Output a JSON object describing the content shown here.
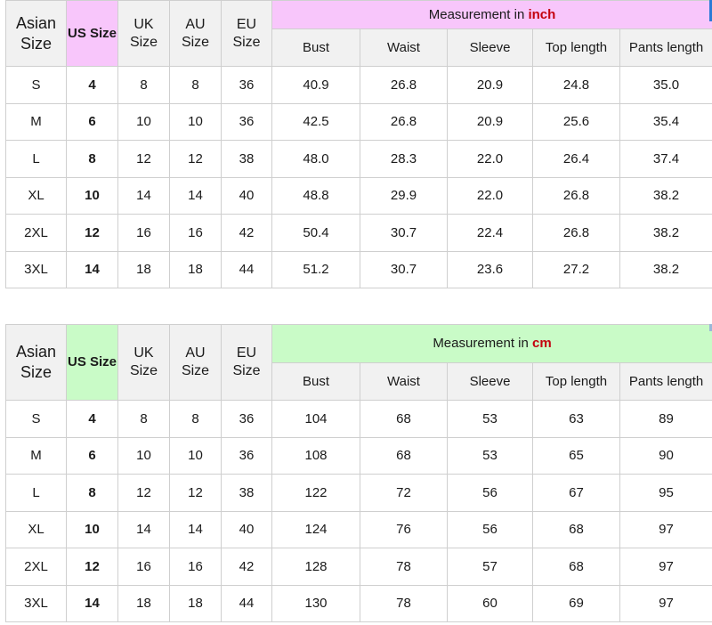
{
  "headers": {
    "asian": "Asian Size",
    "us": "US Size",
    "uk": "UK Size",
    "au": "AU Size",
    "eu": "EU Size",
    "columns": [
      "Bust",
      "Waist",
      "Sleeve",
      "Top length",
      "Pants length"
    ]
  },
  "inch_table": {
    "measurement_prefix": "Measurement in ",
    "unit": "inch",
    "header_highlight_color": "#f8c6fb",
    "rows": [
      [
        "S",
        "4",
        "8",
        "8",
        "36",
        "40.9",
        "26.8",
        "20.9",
        "24.8",
        "35.0"
      ],
      [
        "M",
        "6",
        "10",
        "10",
        "36",
        "42.5",
        "26.8",
        "20.9",
        "25.6",
        "35.4"
      ],
      [
        "L",
        "8",
        "12",
        "12",
        "38",
        "48.0",
        "28.3",
        "22.0",
        "26.4",
        "37.4"
      ],
      [
        "XL",
        "10",
        "14",
        "14",
        "40",
        "48.8",
        "29.9",
        "22.0",
        "26.8",
        "38.2"
      ],
      [
        "2XL",
        "12",
        "16",
        "16",
        "42",
        "50.4",
        "30.7",
        "22.4",
        "26.8",
        "38.2"
      ],
      [
        "3XL",
        "14",
        "18",
        "18",
        "44",
        "51.2",
        "30.7",
        "23.6",
        "27.2",
        "38.2"
      ]
    ]
  },
  "cm_table": {
    "measurement_prefix": "Measurement in ",
    "unit": "cm",
    "header_highlight_color": "#c9fbc7",
    "rows": [
      [
        "S",
        "4",
        "8",
        "8",
        "36",
        "104",
        "68",
        "53",
        "63",
        "89"
      ],
      [
        "M",
        "6",
        "10",
        "10",
        "36",
        "108",
        "68",
        "53",
        "65",
        "90"
      ],
      [
        "L",
        "8",
        "12",
        "12",
        "38",
        "122",
        "72",
        "56",
        "67",
        "95"
      ],
      [
        "XL",
        "10",
        "14",
        "14",
        "40",
        "124",
        "76",
        "56",
        "68",
        "97"
      ],
      [
        "2XL",
        "12",
        "16",
        "16",
        "42",
        "128",
        "78",
        "57",
        "68",
        "97"
      ],
      [
        "3XL",
        "14",
        "18",
        "18",
        "44",
        "130",
        "78",
        "60",
        "69",
        "97"
      ]
    ]
  },
  "unit_color": "#c4000d"
}
